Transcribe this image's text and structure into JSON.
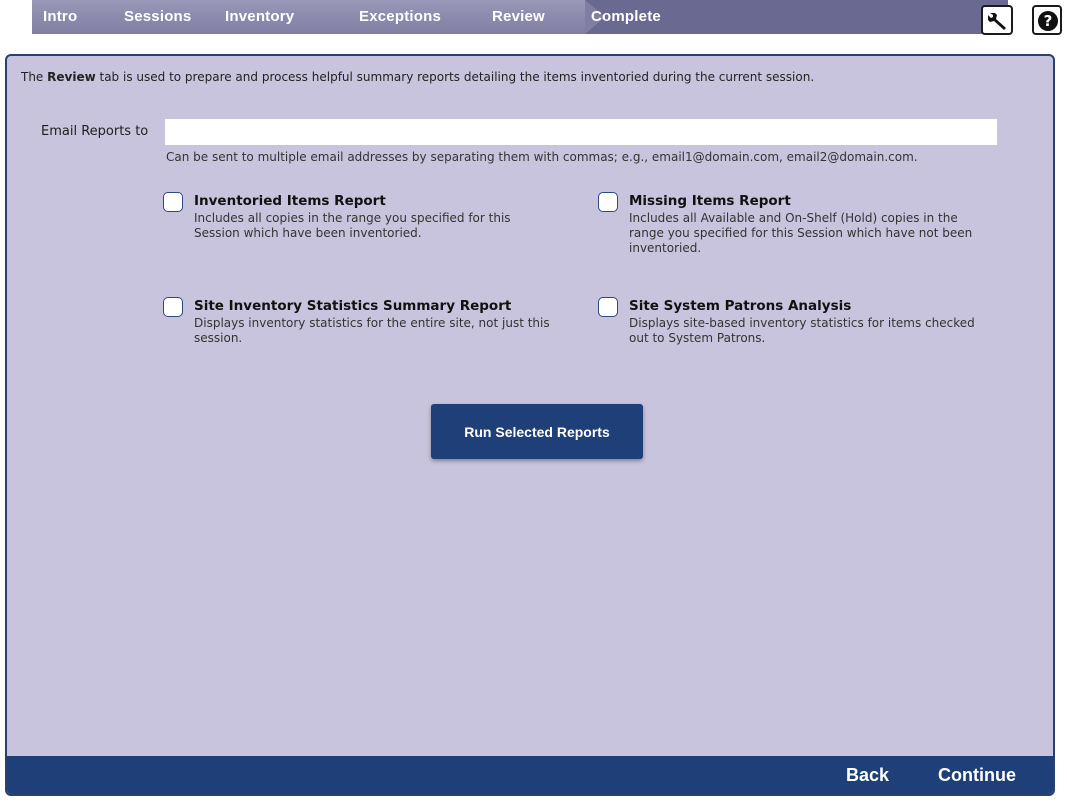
{
  "nav": {
    "tabs": [
      {
        "label": "Intro"
      },
      {
        "label": "Sessions"
      },
      {
        "label": "Inventory"
      },
      {
        "label": "Exceptions"
      },
      {
        "label": "Review"
      },
      {
        "label": "Complete"
      }
    ],
    "active_tab": "Complete",
    "tools": [
      {
        "icon": "wrench-icon"
      },
      {
        "icon": "help-icon"
      }
    ]
  },
  "intro": {
    "prefix": "The ",
    "bold": "Review",
    "suffix": " tab is used to prepare and process helpful summary reports detailing the items inventoried during the current session."
  },
  "email": {
    "label": "Email Reports to",
    "value": "",
    "hint": "Can be sent to multiple email addresses by separating them with commas; e.g., email1@domain.com, email2@domain.com."
  },
  "reports": [
    {
      "title": "Inventoried Items Report",
      "description": "Includes all copies in the range you specified for this Session which have been inventoried.",
      "checked": false
    },
    {
      "title": "Missing Items Report",
      "description": "Includes all Available and On-Shelf (Hold) copies in the range you specified for this Session which have not been inventoried.",
      "checked": false
    },
    {
      "title": "Site Inventory Statistics Summary Report",
      "description": "Displays inventory statistics for the entire site, not just this session.",
      "checked": false
    },
    {
      "title": "Site System Patrons Analysis",
      "description": "Displays site-based inventory statistics for items checked out to System Patrons.",
      "checked": false
    }
  ],
  "run_button": "Run Selected Reports",
  "footer": {
    "back": "Back",
    "continue": "Continue"
  },
  "colors": {
    "tab_strip": "#807ea2",
    "active_tab": "#6a6992",
    "panel_bg": "#c9c4dd",
    "primary": "#1f3f78"
  }
}
